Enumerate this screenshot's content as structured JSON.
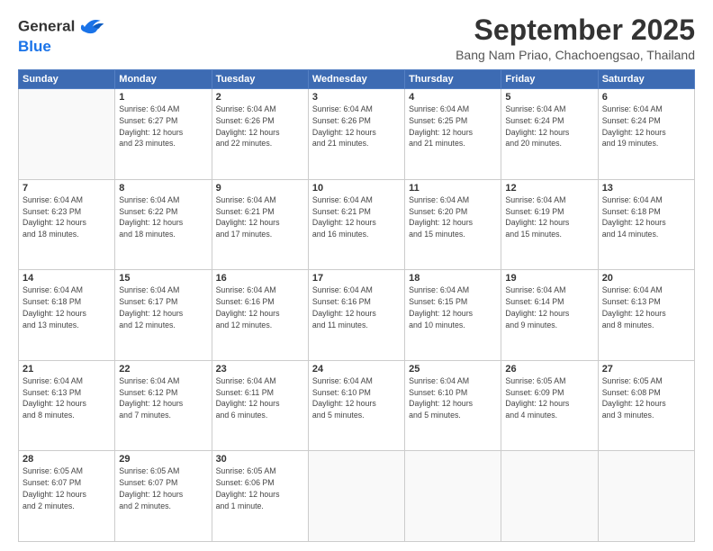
{
  "header": {
    "logo_line1": "General",
    "logo_line2": "Blue",
    "title": "September 2025",
    "subtitle": "Bang Nam Priao, Chachoengsao, Thailand"
  },
  "days_of_week": [
    "Sunday",
    "Monday",
    "Tuesday",
    "Wednesday",
    "Thursday",
    "Friday",
    "Saturday"
  ],
  "weeks": [
    [
      {
        "day": "",
        "empty": true
      },
      {
        "day": "1",
        "sunrise": "Sunrise: 6:04 AM",
        "sunset": "Sunset: 6:27 PM",
        "daylight": "Daylight: 12 hours and 23 minutes."
      },
      {
        "day": "2",
        "sunrise": "Sunrise: 6:04 AM",
        "sunset": "Sunset: 6:26 PM",
        "daylight": "Daylight: 12 hours and 22 minutes."
      },
      {
        "day": "3",
        "sunrise": "Sunrise: 6:04 AM",
        "sunset": "Sunset: 6:26 PM",
        "daylight": "Daylight: 12 hours and 21 minutes."
      },
      {
        "day": "4",
        "sunrise": "Sunrise: 6:04 AM",
        "sunset": "Sunset: 6:25 PM",
        "daylight": "Daylight: 12 hours and 21 minutes."
      },
      {
        "day": "5",
        "sunrise": "Sunrise: 6:04 AM",
        "sunset": "Sunset: 6:24 PM",
        "daylight": "Daylight: 12 hours and 20 minutes."
      },
      {
        "day": "6",
        "sunrise": "Sunrise: 6:04 AM",
        "sunset": "Sunset: 6:24 PM",
        "daylight": "Daylight: 12 hours and 19 minutes."
      }
    ],
    [
      {
        "day": "7",
        "sunrise": "Sunrise: 6:04 AM",
        "sunset": "Sunset: 6:23 PM",
        "daylight": "Daylight: 12 hours and 18 minutes."
      },
      {
        "day": "8",
        "sunrise": "Sunrise: 6:04 AM",
        "sunset": "Sunset: 6:22 PM",
        "daylight": "Daylight: 12 hours and 18 minutes."
      },
      {
        "day": "9",
        "sunrise": "Sunrise: 6:04 AM",
        "sunset": "Sunset: 6:21 PM",
        "daylight": "Daylight: 12 hours and 17 minutes."
      },
      {
        "day": "10",
        "sunrise": "Sunrise: 6:04 AM",
        "sunset": "Sunset: 6:21 PM",
        "daylight": "Daylight: 12 hours and 16 minutes."
      },
      {
        "day": "11",
        "sunrise": "Sunrise: 6:04 AM",
        "sunset": "Sunset: 6:20 PM",
        "daylight": "Daylight: 12 hours and 15 minutes."
      },
      {
        "day": "12",
        "sunrise": "Sunrise: 6:04 AM",
        "sunset": "Sunset: 6:19 PM",
        "daylight": "Daylight: 12 hours and 15 minutes."
      },
      {
        "day": "13",
        "sunrise": "Sunrise: 6:04 AM",
        "sunset": "Sunset: 6:18 PM",
        "daylight": "Daylight: 12 hours and 14 minutes."
      }
    ],
    [
      {
        "day": "14",
        "sunrise": "Sunrise: 6:04 AM",
        "sunset": "Sunset: 6:18 PM",
        "daylight": "Daylight: 12 hours and 13 minutes."
      },
      {
        "day": "15",
        "sunrise": "Sunrise: 6:04 AM",
        "sunset": "Sunset: 6:17 PM",
        "daylight": "Daylight: 12 hours and 12 minutes."
      },
      {
        "day": "16",
        "sunrise": "Sunrise: 6:04 AM",
        "sunset": "Sunset: 6:16 PM",
        "daylight": "Daylight: 12 hours and 12 minutes."
      },
      {
        "day": "17",
        "sunrise": "Sunrise: 6:04 AM",
        "sunset": "Sunset: 6:16 PM",
        "daylight": "Daylight: 12 hours and 11 minutes."
      },
      {
        "day": "18",
        "sunrise": "Sunrise: 6:04 AM",
        "sunset": "Sunset: 6:15 PM",
        "daylight": "Daylight: 12 hours and 10 minutes."
      },
      {
        "day": "19",
        "sunrise": "Sunrise: 6:04 AM",
        "sunset": "Sunset: 6:14 PM",
        "daylight": "Daylight: 12 hours and 9 minutes."
      },
      {
        "day": "20",
        "sunrise": "Sunrise: 6:04 AM",
        "sunset": "Sunset: 6:13 PM",
        "daylight": "Daylight: 12 hours and 8 minutes."
      }
    ],
    [
      {
        "day": "21",
        "sunrise": "Sunrise: 6:04 AM",
        "sunset": "Sunset: 6:13 PM",
        "daylight": "Daylight: 12 hours and 8 minutes."
      },
      {
        "day": "22",
        "sunrise": "Sunrise: 6:04 AM",
        "sunset": "Sunset: 6:12 PM",
        "daylight": "Daylight: 12 hours and 7 minutes."
      },
      {
        "day": "23",
        "sunrise": "Sunrise: 6:04 AM",
        "sunset": "Sunset: 6:11 PM",
        "daylight": "Daylight: 12 hours and 6 minutes."
      },
      {
        "day": "24",
        "sunrise": "Sunrise: 6:04 AM",
        "sunset": "Sunset: 6:10 PM",
        "daylight": "Daylight: 12 hours and 5 minutes."
      },
      {
        "day": "25",
        "sunrise": "Sunrise: 6:04 AM",
        "sunset": "Sunset: 6:10 PM",
        "daylight": "Daylight: 12 hours and 5 minutes."
      },
      {
        "day": "26",
        "sunrise": "Sunrise: 6:05 AM",
        "sunset": "Sunset: 6:09 PM",
        "daylight": "Daylight: 12 hours and 4 minutes."
      },
      {
        "day": "27",
        "sunrise": "Sunrise: 6:05 AM",
        "sunset": "Sunset: 6:08 PM",
        "daylight": "Daylight: 12 hours and 3 minutes."
      }
    ],
    [
      {
        "day": "28",
        "sunrise": "Sunrise: 6:05 AM",
        "sunset": "Sunset: 6:07 PM",
        "daylight": "Daylight: 12 hours and 2 minutes."
      },
      {
        "day": "29",
        "sunrise": "Sunrise: 6:05 AM",
        "sunset": "Sunset: 6:07 PM",
        "daylight": "Daylight: 12 hours and 2 minutes."
      },
      {
        "day": "30",
        "sunrise": "Sunrise: 6:05 AM",
        "sunset": "Sunset: 6:06 PM",
        "daylight": "Daylight: 12 hours and 1 minute."
      },
      {
        "day": "",
        "empty": true
      },
      {
        "day": "",
        "empty": true
      },
      {
        "day": "",
        "empty": true
      },
      {
        "day": "",
        "empty": true
      }
    ]
  ]
}
